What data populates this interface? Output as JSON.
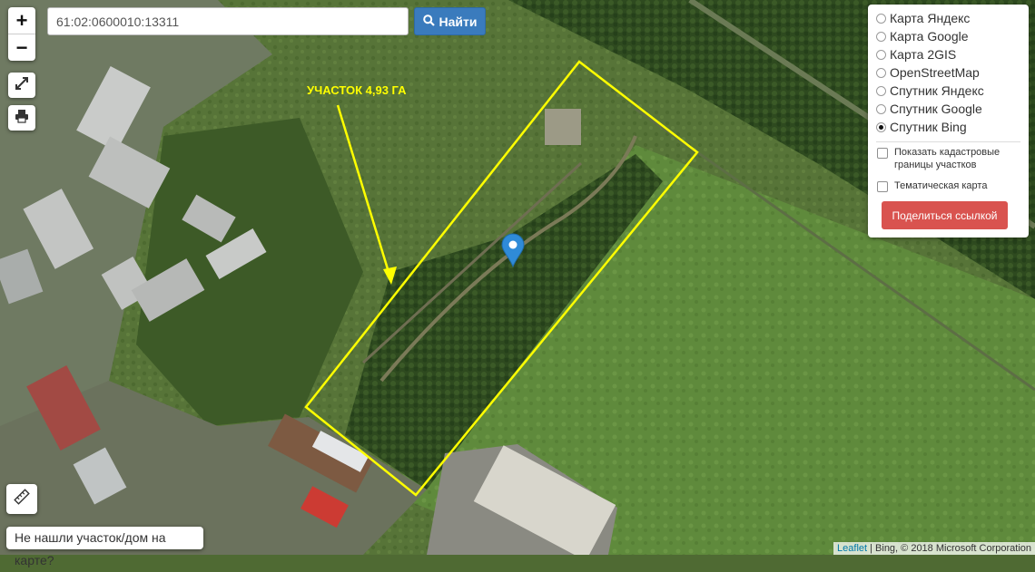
{
  "map": {
    "annotation_text": "УЧАСТОК 4,93 ГА",
    "annotation_color": "#ffff00",
    "boundary_color": "#ffff00",
    "marker_color": "#2f8bd8"
  },
  "zoom": {
    "in_label": "+",
    "out_label": "−"
  },
  "tools": {
    "fullscreen_icon": "expand-icon",
    "print_icon": "print-icon",
    "ruler_icon": "ruler-icon"
  },
  "search": {
    "value": "61:02:0600010:13311",
    "button_label": "Найти",
    "button_icon": "search-icon"
  },
  "layers": {
    "options": [
      {
        "label": "Карта Яндекс",
        "selected": false
      },
      {
        "label": "Карта Google",
        "selected": false
      },
      {
        "label": "Карта 2GIS",
        "selected": false
      },
      {
        "label": "OpenStreetMap",
        "selected": false
      },
      {
        "label": "Спутник Яндекс",
        "selected": false
      },
      {
        "label": "Спутник Google",
        "selected": false
      },
      {
        "label": "Спутник Bing",
        "selected": true
      }
    ],
    "show_cadastral_label": "Показать кадастровые границы участков",
    "thematic_label": "Тематическая карта",
    "share_button": "Поделиться ссылкой"
  },
  "bottom": {
    "not_found_label": "Не нашли участок/дом на карте?"
  },
  "attribution": {
    "leaflet": "Leaflet",
    "text": " | Bing, © 2018 Microsoft Corporation"
  }
}
